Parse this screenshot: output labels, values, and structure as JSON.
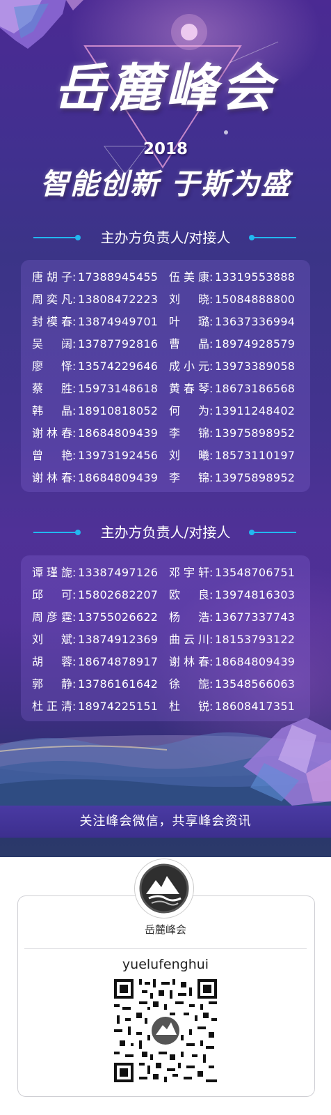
{
  "header": {
    "title": "岳麓峰会",
    "year": "2018",
    "slogan": "智能创新 于斯为盛"
  },
  "sections": [
    {
      "heading": "主办方负责人/对接人",
      "rows": [
        {
          "left": {
            "name": "唐胡子",
            "phone": "17388945455"
          },
          "right": {
            "name": "伍美康",
            "phone": "13319553888"
          }
        },
        {
          "left": {
            "name": "周奕凡",
            "phone": "13808472223"
          },
          "right": {
            "name": "刘晓",
            "phone": "15084888800"
          }
        },
        {
          "left": {
            "name": "封模春",
            "phone": "13874949701"
          },
          "right": {
            "name": "叶璐",
            "phone": "13637336994"
          }
        },
        {
          "left": {
            "name": "吴阔",
            "phone": "13787792816"
          },
          "right": {
            "name": "曹晶",
            "phone": "18974928579"
          }
        },
        {
          "left": {
            "name": "廖怿",
            "phone": "13574229646"
          },
          "right": {
            "name": "成小元",
            "phone": "13973389058"
          }
        },
        {
          "left": {
            "name": "蔡胜",
            "phone": "15973148618"
          },
          "right": {
            "name": "黄春琴",
            "phone": "18673186568"
          }
        },
        {
          "left": {
            "name": "韩晶",
            "phone": "18910818052"
          },
          "right": {
            "name": "何为",
            "phone": "13911248402"
          }
        },
        {
          "left": {
            "name": "谢林春",
            "phone": "18684809439"
          },
          "right": {
            "name": "李锦",
            "phone": "13975898952"
          }
        },
        {
          "left": {
            "name": "曾艳",
            "phone": "13973192456"
          },
          "right": {
            "name": "刘曦",
            "phone": "18573110197"
          }
        },
        {
          "left": {
            "name": "谢林春",
            "phone": "18684809439"
          },
          "right": {
            "name": "李锦",
            "phone": "13975898952"
          }
        }
      ]
    },
    {
      "heading": "主办方负责人/对接人",
      "rows": [
        {
          "left": {
            "name": "谭瑾旎",
            "phone": "13387497126"
          },
          "right": {
            "name": "邓宇轩",
            "phone": "13548706751"
          }
        },
        {
          "left": {
            "name": "邱可",
            "phone": "15802682207"
          },
          "right": {
            "name": "欧良",
            "phone": "13974816303"
          }
        },
        {
          "left": {
            "name": "周彦霆",
            "phone": "13755026622"
          },
          "right": {
            "name": "杨浩",
            "phone": "13677337743"
          }
        },
        {
          "left": {
            "name": "刘斌",
            "phone": "13874912369"
          },
          "right": {
            "name": "曲云川",
            "phone": "18153793122"
          }
        },
        {
          "left": {
            "name": "胡蓉",
            "phone": "18674878917"
          },
          "right": {
            "name": "谢林春",
            "phone": "18684809439"
          }
        },
        {
          "left": {
            "name": "郭静",
            "phone": "13786161642"
          },
          "right": {
            "name": "徐旎",
            "phone": "13548566063"
          }
        },
        {
          "left": {
            "name": "杜正清",
            "phone": "18974225151"
          },
          "right": {
            "name": "杜锐",
            "phone": "18608417351"
          }
        }
      ]
    }
  ],
  "banner": {
    "text": "关注峰会微信，共享峰会资讯"
  },
  "wechat": {
    "logo_icon": "mountain-logo-icon",
    "account_name": "岳麓峰会",
    "account_id": "yuelufenghui",
    "qr_icon": "qr-code-icon"
  },
  "colors": {
    "background_purple": "#4b2a93",
    "accent_cyan": "#22b8f0",
    "banner": "#4a3aa3"
  }
}
